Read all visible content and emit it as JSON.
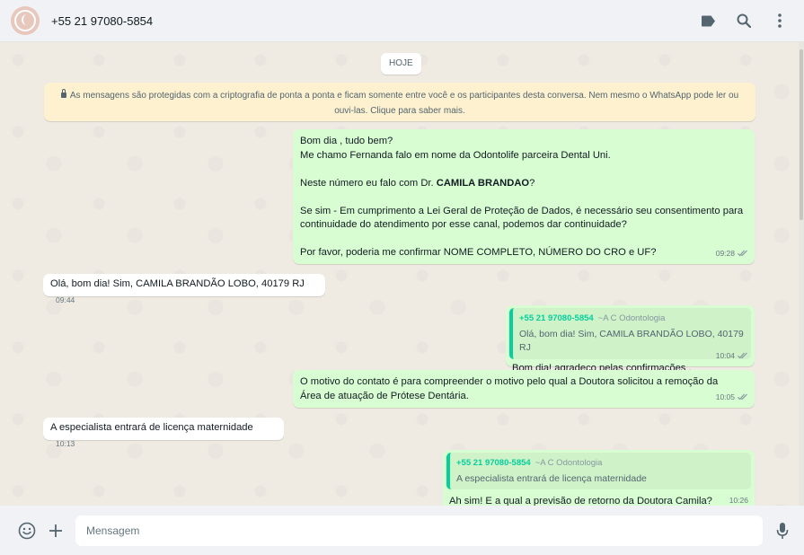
{
  "header": {
    "contact_name": "+55 21 97080-5854",
    "icons": [
      "label-icon",
      "search-icon",
      "menu-icon"
    ]
  },
  "chat": {
    "date_label": "HOJE",
    "encryption_notice": "As mensagens são protegidas com a criptografia de ponta a ponta e ficam somente entre você e os participantes desta conversa. Nem mesmo o WhatsApp pode ler ou ouvi-las. Clique para saber mais.",
    "messages": [
      {
        "direction": "outgoing",
        "lines": [
          "Bom dia , tudo bem?",
          "Me chamo Fernanda falo em nome da Odontolife parceira Dental Uni.",
          "",
          "Neste número eu falo com Dr. ",
          "",
          "Se sim - Em cumprimento a Lei Geral de Proteção de Dados, é necessário seu consentimento para",
          "continuidade do atendimento por esse canal, podemos dar continuidade?",
          "",
          "Por favor, poderia me confirmar NOME COMPLETO, NÚMERO DO CRO e UF?"
        ],
        "bold_name": "CAMILA BRANDAO",
        "question_mark": "?",
        "time": "09:28"
      },
      {
        "direction": "incoming",
        "text": "Olá, bom dia! Sim, CAMILA BRANDÃO LOBO, 40179 RJ",
        "time": "09:44"
      },
      {
        "direction": "outgoing",
        "quote_author": "+55 21 97080-5854",
        "quote_pushname": "~A C Odontologia",
        "quote_text": "Olá, bom dia! Sim, CAMILA BRANDÃO LOBO, 40179 RJ",
        "text": "Bom dia! agradeço pelas confirmações .",
        "time": "10:04"
      },
      {
        "direction": "outgoing",
        "lines": [
          "O motivo do contato é para compreender o motivo pelo qual a Doutora solicitou a remoção da",
          "Área de atuação de Prótese Dentária."
        ],
        "time": "10:05"
      },
      {
        "direction": "incoming",
        "text": "A especialista entrará de licença maternidade",
        "time": "10:13"
      },
      {
        "direction": "outgoing",
        "quote_author": "+55 21 97080-5854",
        "quote_pushname": "~A C Odontologia",
        "quote_text": "A especialista entrará de licença maternidade",
        "text": "Ah sim! E a qual a previsão de retorno da Doutora Camila?",
        "time": "10:26"
      }
    ]
  },
  "footer": {
    "placeholder": "Mensagem",
    "icons": [
      "emoji-icon",
      "plus-icon",
      "microphone-icon"
    ]
  },
  "colors": {
    "outgoing_bubble": "#d9fdd3",
    "incoming_bubble": "#ffffff",
    "chat_background": "#efeae2",
    "quote_accent": "#06cf9c",
    "notice_background": "#fdf1cf"
  }
}
